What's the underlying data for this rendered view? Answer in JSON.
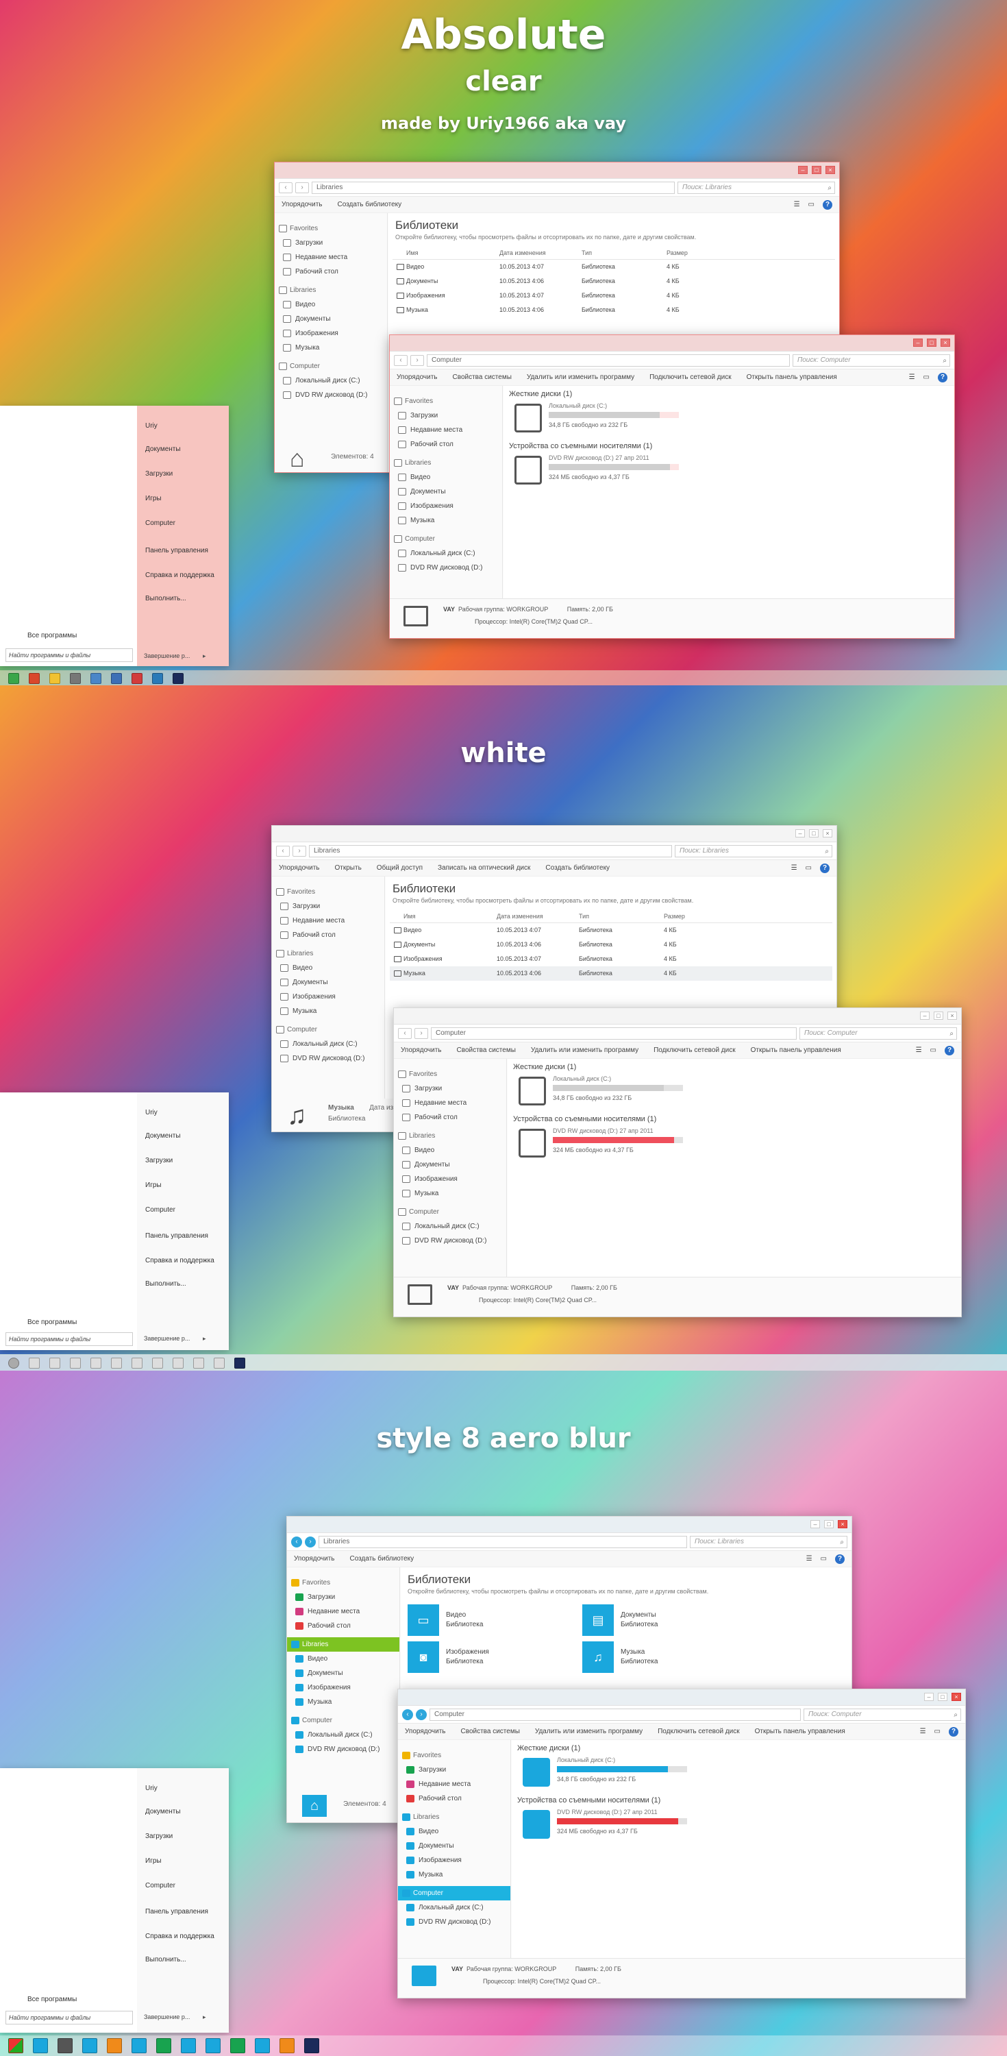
{
  "titles": {
    "s1_line1": "Absolute",
    "s1_line2": "clear",
    "s1_credit": "made by Uriy1966 aka vay",
    "s2": "white",
    "s3": "style 8 aero blur"
  },
  "lib": {
    "address": "Libraries",
    "search": "Поиск: Libraries",
    "toolbar_s1": [
      "Упорядочить",
      "Создать библиотеку"
    ],
    "toolbar_s2": [
      "Упорядочить",
      "Открыть",
      "Общий доступ",
      "Записать на оптический диск",
      "Создать библиотеку"
    ],
    "title": "Библиотеки",
    "subtitle": "Откройте библиотеку, чтобы просмотреть файлы и отсортировать их по папке, дате и другим свойствам.",
    "columns": [
      "Имя",
      "Дата изменения",
      "Тип",
      "Размер"
    ],
    "rows": [
      {
        "name": "Видео",
        "date": "10.05.2013 4:07",
        "type": "Библиотека",
        "size": "4 КБ"
      },
      {
        "name": "Документы",
        "date": "10.05.2013 4:06",
        "type": "Библиотека",
        "size": "4 КБ"
      },
      {
        "name": "Изображения",
        "date": "10.05.2013 4:07",
        "type": "Библиотека",
        "size": "4 КБ"
      },
      {
        "name": "Музыка",
        "date": "10.05.2013 4:06",
        "type": "Библиотека",
        "size": "4 КБ"
      }
    ],
    "tile_sub": "Библиотека",
    "status": "Элементов: 4",
    "music_detail": "Музыка",
    "music_detail_sub": "Библиотека",
    "music_date_label": "Дата изменения"
  },
  "nav": {
    "favorites": "Favorites",
    "downloads": "Загрузки",
    "recent": "Недавние места",
    "desktop": "Рабочий стол",
    "libraries": "Libraries",
    "video": "Видео",
    "docs": "Документы",
    "images": "Изображения",
    "music": "Музыка",
    "computer": "Computer",
    "disk_c": "Локальный диск (C:)",
    "disk_d": "DVD RW дисковод (D:)"
  },
  "comp": {
    "address": "Computer",
    "search": "Поиск: Computer",
    "toolbar": [
      "Упорядочить",
      "Свойства системы",
      "Удалить или изменить программу",
      "Подключить сетевой диск",
      "Открыть панель управления"
    ],
    "hdd_section": "Жесткие диски (1)",
    "c_name": "Локальный диск (C:)",
    "c_free": "34,8 ГБ свободно из 232 ГБ",
    "c_used": 0.85,
    "removable_section": "Устройства со съемными носителями (1)",
    "d_name": "DVD RW дисковод (D:) 27 апр 2011",
    "d_free": "324 МБ свободно из 4,37 ГБ",
    "d_used": 0.93,
    "pc_name": "VAY",
    "workgroup_label": "Рабочая группа:",
    "workgroup": "WORKGROUP",
    "memory_label": "Память:",
    "memory": "2,00 ГБ",
    "cpu_label": "Процессор:",
    "cpu": "Intel(R) Core(TM)2 Quad CP..."
  },
  "start": {
    "right": [
      "Uriy",
      "Документы",
      "Загрузки",
      "Игры",
      "Computer",
      "Панель управления",
      "Справка и поддержка",
      "Выполнить..."
    ],
    "all_programs": "Все программы",
    "search": "Найти программы и файлы",
    "shutdown": "Завершение р..."
  },
  "colors": {
    "s3_blue": "#1aa7dd",
    "s3_green": "#7dc322",
    "s2_red": "#ef4f5c",
    "s3_red": "#e8393f",
    "help": "#2a6fc9"
  }
}
